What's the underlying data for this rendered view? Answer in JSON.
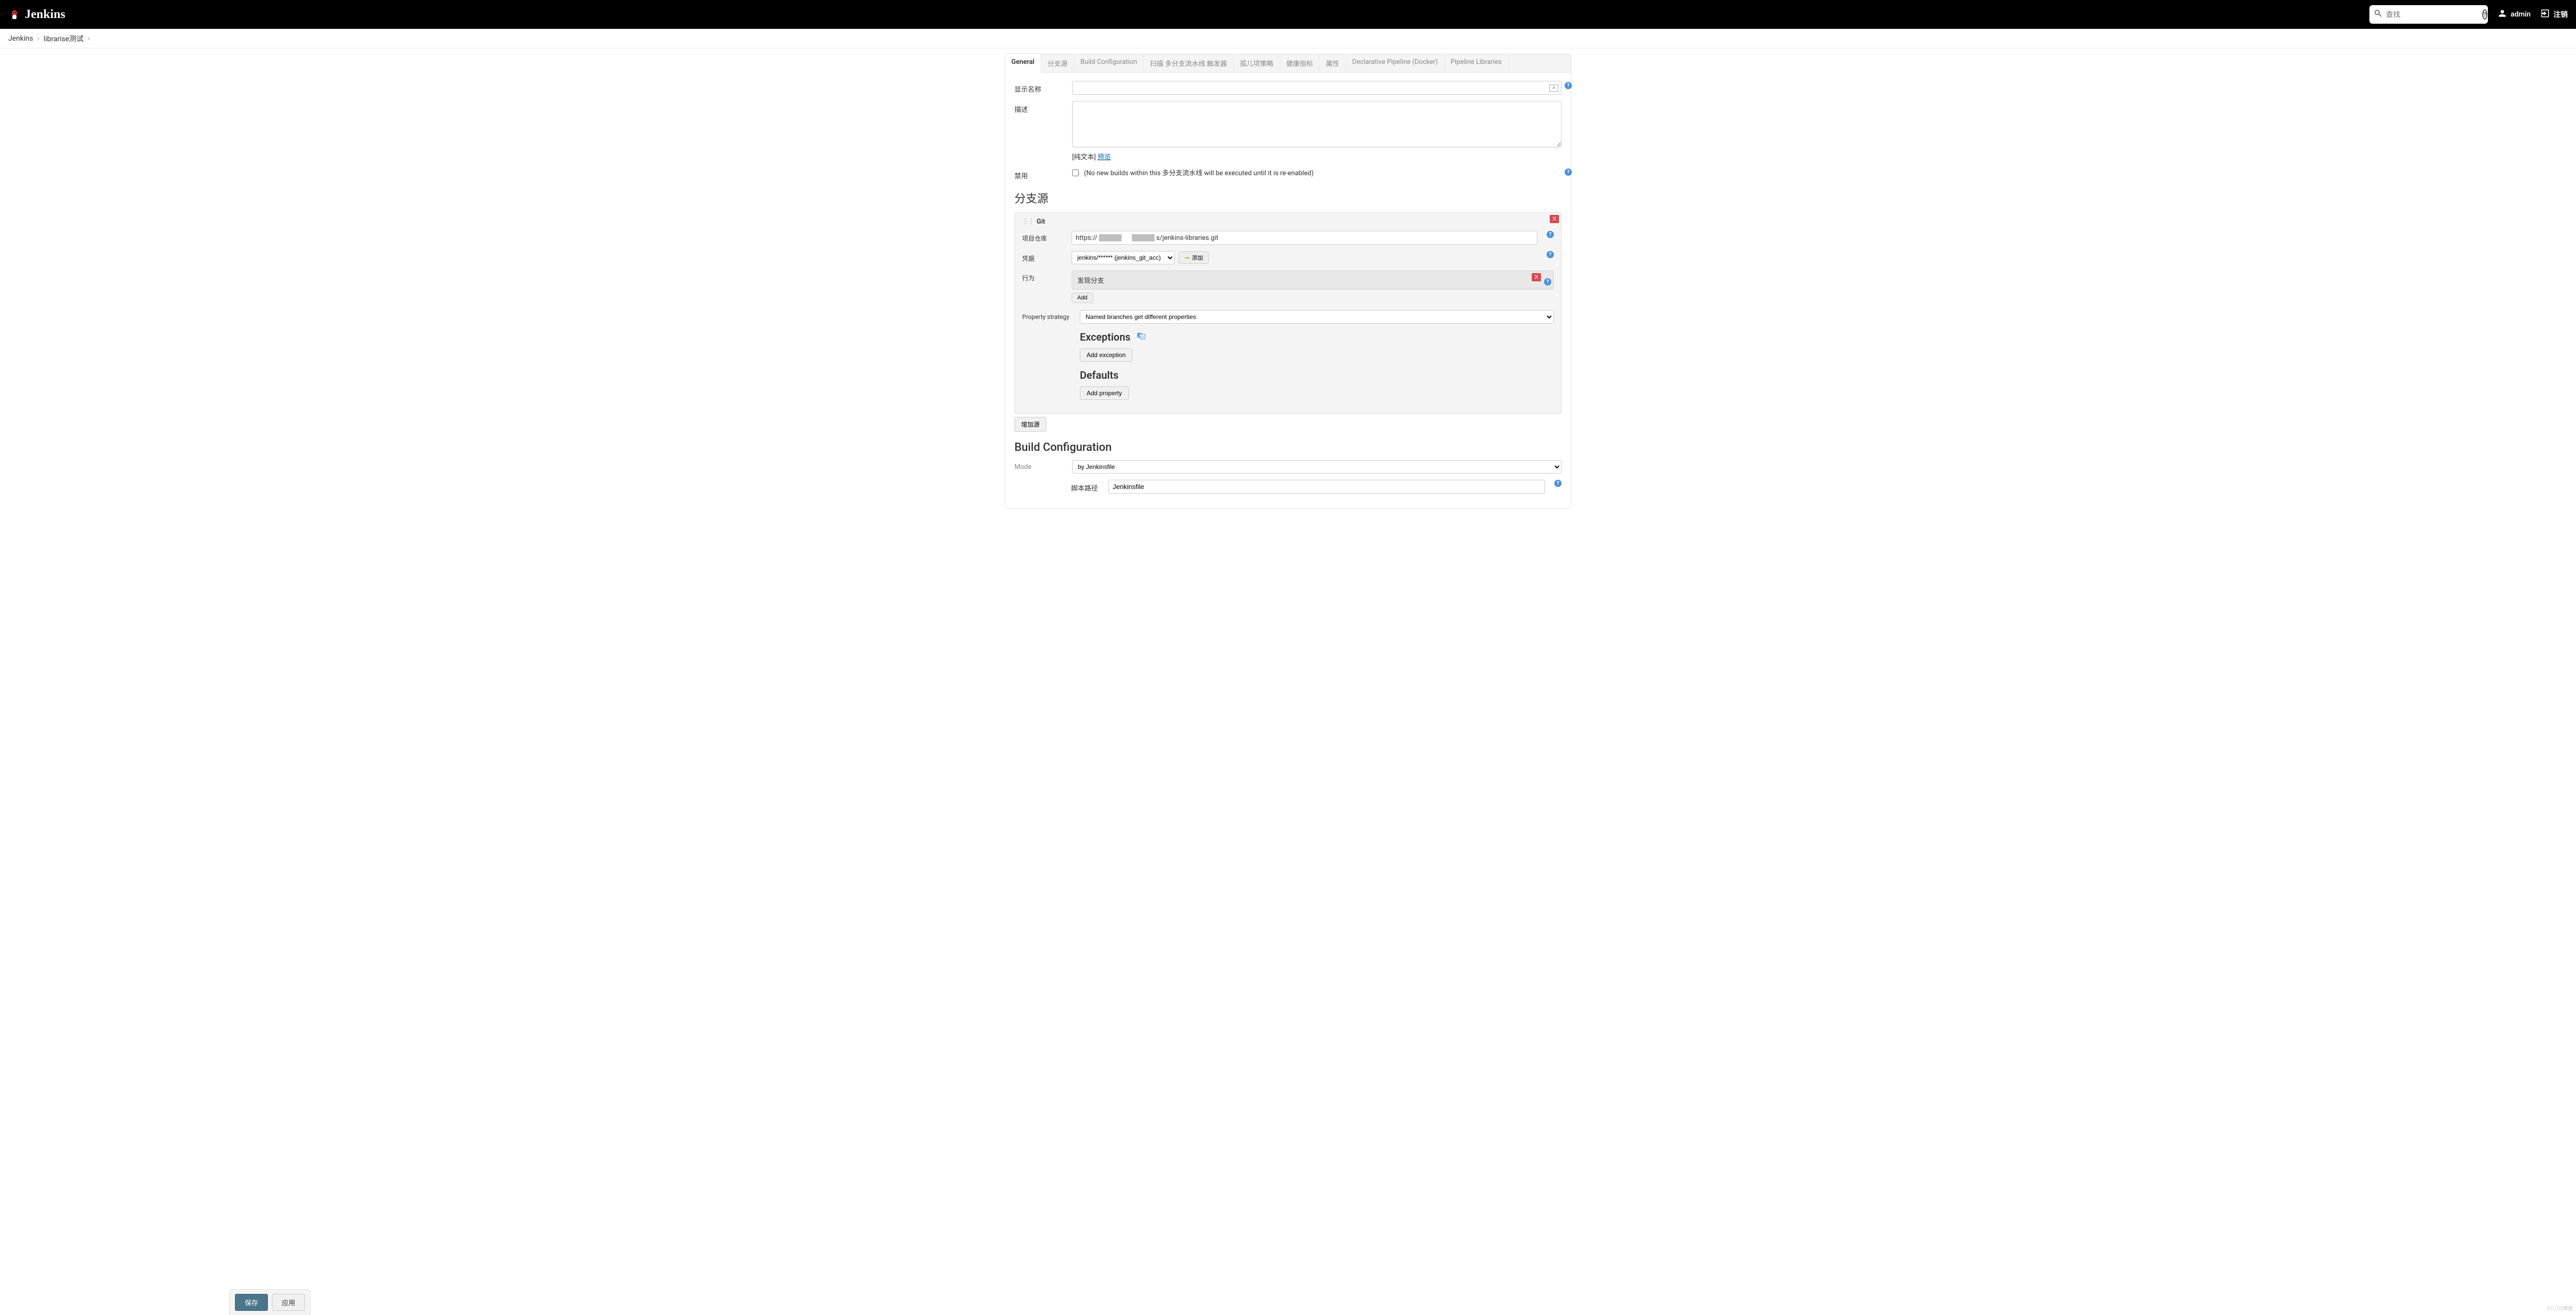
{
  "header": {
    "brand": "Jenkins",
    "search_placeholder": "查找",
    "user": "admin",
    "logout": "注销"
  },
  "breadcrumbs": [
    {
      "label": "Jenkins"
    },
    {
      "label": "librarise测试"
    }
  ],
  "tabs": [
    {
      "id": "general",
      "label": "General",
      "active": true
    },
    {
      "id": "branch-sources",
      "label": "分支源",
      "active": false
    },
    {
      "id": "build-config",
      "label": "Build Configuration",
      "active": false
    },
    {
      "id": "scan-triggers",
      "label": "扫描 多分支流水线 触发器",
      "active": false
    },
    {
      "id": "orphan",
      "label": "孤儿项策略",
      "active": false
    },
    {
      "id": "health",
      "label": "健康指标",
      "active": false
    },
    {
      "id": "props",
      "label": "属性",
      "active": false
    },
    {
      "id": "decl-pipeline",
      "label": "Declarative Pipeline (Docker)",
      "active": false
    },
    {
      "id": "pipeline-libs",
      "label": "Pipeline Libraries",
      "active": false
    }
  ],
  "general": {
    "display_name_label": "显示名称",
    "display_name_value": "",
    "description_label": "描述",
    "description_value": "",
    "plaintext_prefix": "[纯文本] ",
    "preview_link": "预览",
    "disable_label": "禁用",
    "disable_checked": false,
    "disable_hint": "(No new builds within this 多分支流水线 will be executed until it is re-enabled)"
  },
  "branch_sources": {
    "heading": "分支源",
    "source": {
      "type": "Git",
      "repo_label": "项目仓库",
      "repo_prefix": "https://",
      "repo_suffix": "s/jenkins-libraries.git",
      "cred_label": "凭据",
      "cred_value": "jenkins/****** (jenkins_git_acc)",
      "add_cred": "添加",
      "behaviors_label": "行为",
      "behavior_item": "发现分支",
      "add_behavior": "Add",
      "prop_strategy_label": "Property strategy",
      "prop_strategy_value": "Named branches get different properties",
      "exceptions_heading": "Exceptions",
      "add_exception": "Add exception",
      "defaults_heading": "Defaults",
      "add_property": "Add property"
    },
    "add_source": "增加源"
  },
  "build_config": {
    "heading": "Build Configuration",
    "mode_label": "Mode",
    "mode_value": "by Jenkinsfile",
    "script_path_label": "脚本路径",
    "script_path_value": "Jenkinsfile"
  },
  "actions": {
    "save": "保存",
    "apply": "应用"
  },
  "delete_x": "X"
}
